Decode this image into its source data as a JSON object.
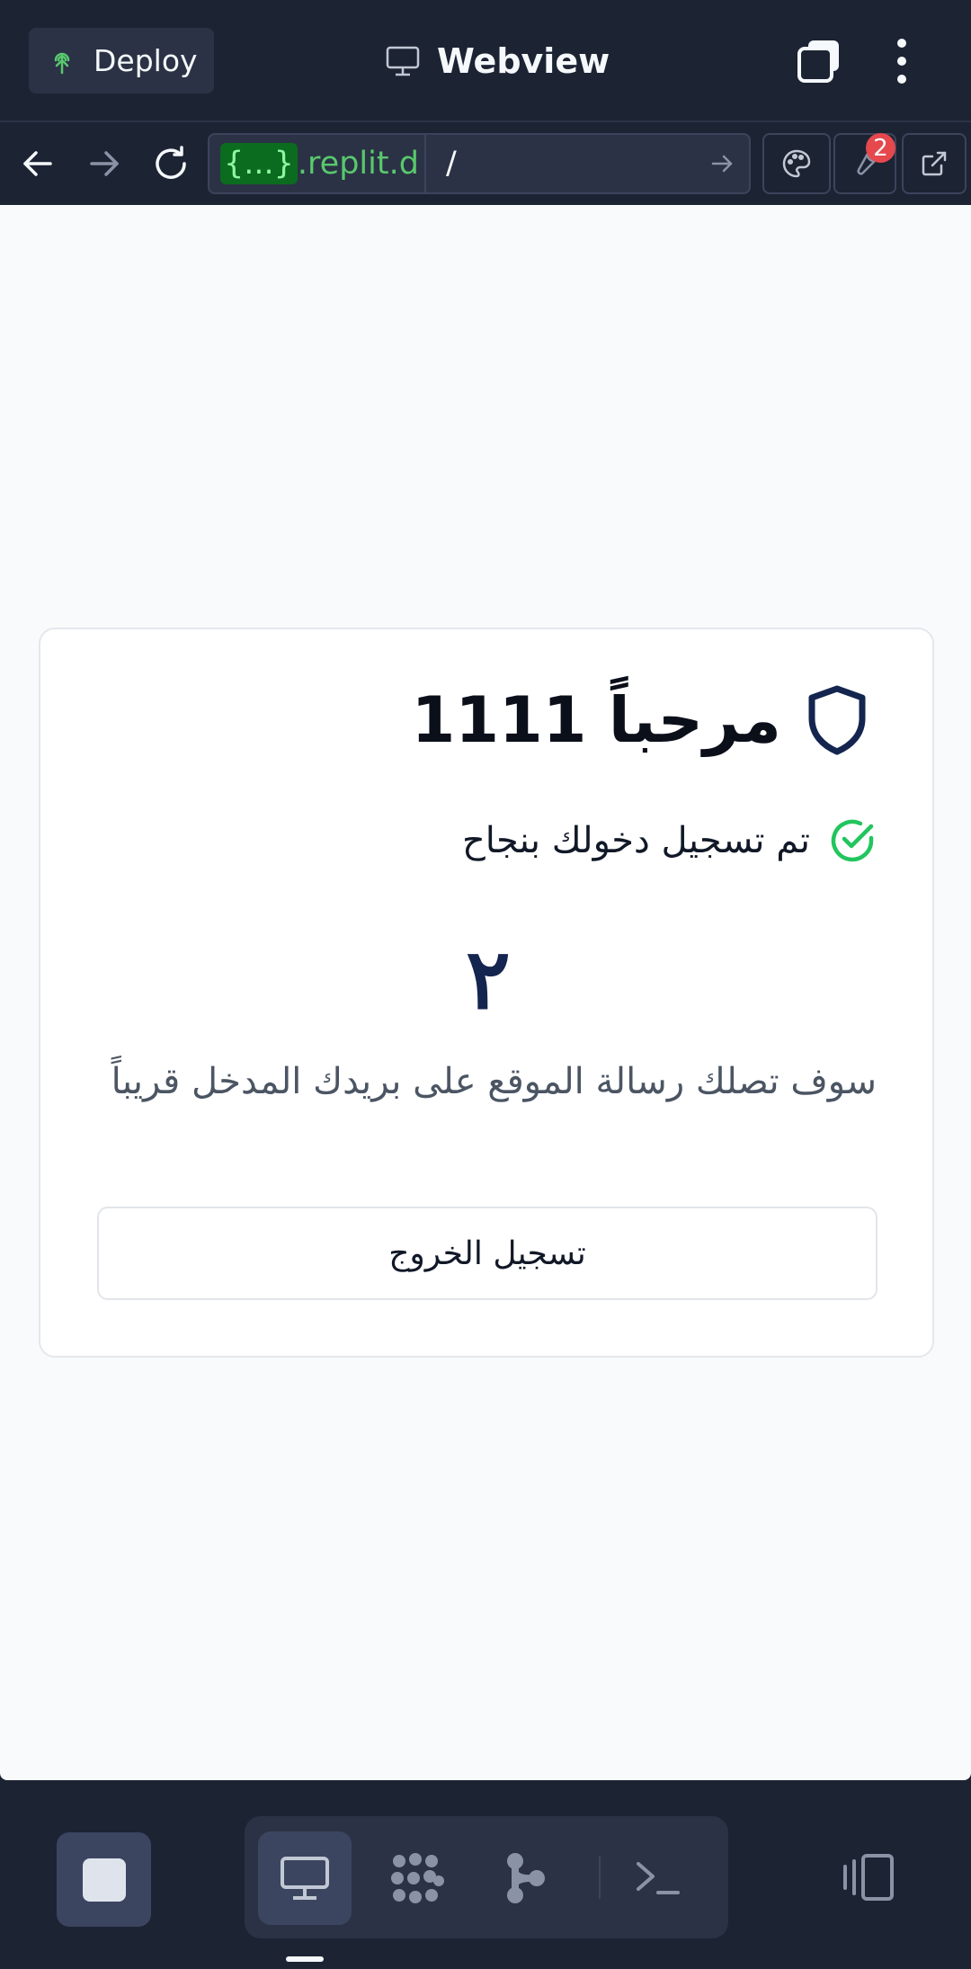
{
  "header": {
    "deploy_label": "Deploy",
    "title": "Webview"
  },
  "addressbar": {
    "host_brace": "{...}",
    "host_rest": ".replit.d",
    "path": "/",
    "devtools_badge": "2"
  },
  "page": {
    "welcome_title": "مرحباً 1111",
    "status_text": "تم تسجيل دخولك بنجاح",
    "big_number": "٢",
    "message": "سوف تصلك رسالة الموقع على بريدك المدخل قريباً",
    "logout_label": "تسجيل الخروج"
  },
  "colors": {
    "chrome_bg": "#1c2333",
    "accent_green": "#58c96d",
    "shield_navy": "#14254f",
    "check_green": "#22c55e",
    "badge_red": "#e5484d"
  },
  "icons": [
    "deploy-icon",
    "monitor-icon",
    "tabs-icon",
    "more-icon",
    "back-arrow-icon",
    "forward-arrow-icon",
    "reload-icon",
    "go-arrow-icon",
    "palette-icon",
    "devtools-icon",
    "external-link-icon",
    "shield-icon",
    "check-circle-icon",
    "stop-icon",
    "webview-icon",
    "workspace-icon",
    "git-icon",
    "shell-icon",
    "panels-icon"
  ]
}
